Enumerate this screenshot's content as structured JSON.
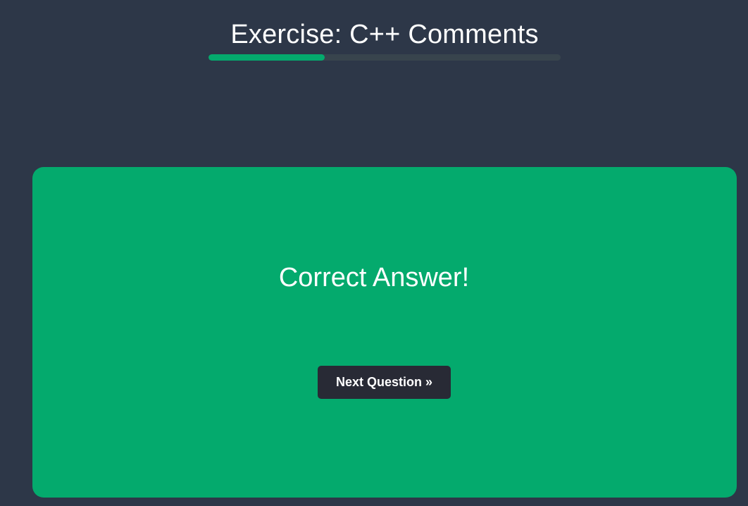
{
  "exercise": {
    "title": "Exercise: C++ Comments",
    "progress": 0.33
  },
  "result": {
    "message": "Correct Answer!",
    "next_label": "Next Question »"
  },
  "colors": {
    "background": "#2d3748",
    "accent": "#04aa6d",
    "progress_track": "#38444d",
    "button": "#282a35"
  }
}
